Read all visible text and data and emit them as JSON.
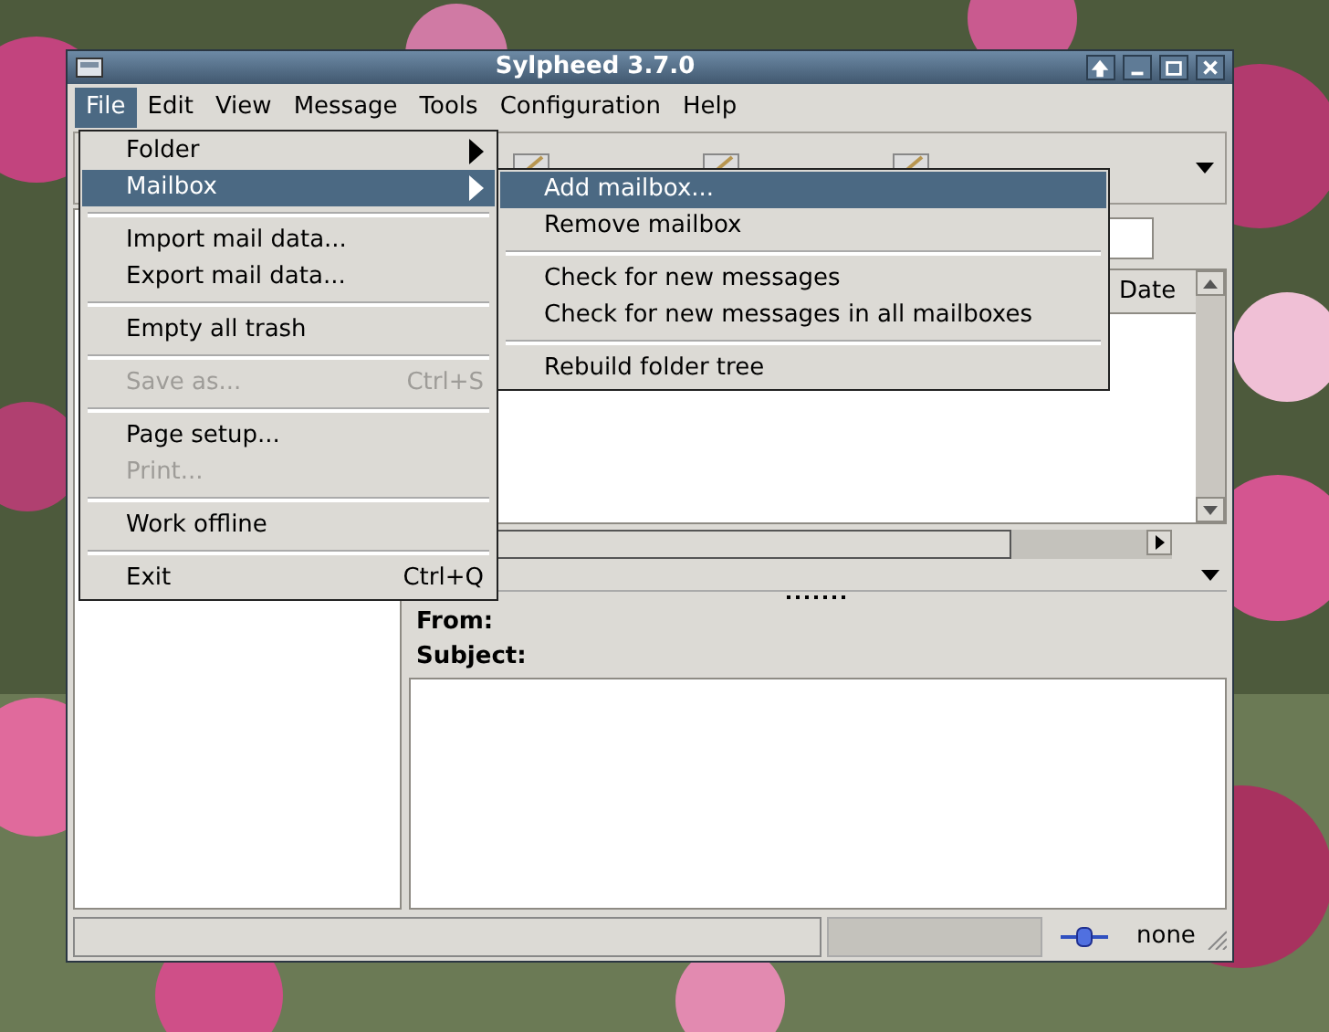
{
  "window": {
    "title": "Sylpheed 3.7.0"
  },
  "menubar": [
    {
      "label": "File",
      "selected": true
    },
    {
      "label": "Edit",
      "selected": false
    },
    {
      "label": "View",
      "selected": false
    },
    {
      "label": "Message",
      "selected": false
    },
    {
      "label": "Tools",
      "selected": false
    },
    {
      "label": "Configuration",
      "selected": false
    },
    {
      "label": "Help",
      "selected": false
    }
  ],
  "file_menu": [
    {
      "kind": "item",
      "label": "Folder",
      "submenu": true,
      "selected": false,
      "disabled": false
    },
    {
      "kind": "item",
      "label": "Mailbox",
      "submenu": true,
      "selected": true,
      "disabled": false
    },
    {
      "kind": "separator"
    },
    {
      "kind": "item",
      "label": "Import mail data...",
      "submenu": false,
      "selected": false,
      "disabled": false
    },
    {
      "kind": "item",
      "label": "Export mail data...",
      "submenu": false,
      "selected": false,
      "disabled": false
    },
    {
      "kind": "separator"
    },
    {
      "kind": "item",
      "label": "Empty all trash",
      "submenu": false,
      "selected": false,
      "disabled": false
    },
    {
      "kind": "separator"
    },
    {
      "kind": "item",
      "label": "Save as...",
      "shortcut": "Ctrl+S",
      "submenu": false,
      "selected": false,
      "disabled": true
    },
    {
      "kind": "separator"
    },
    {
      "kind": "item",
      "label": "Page setup...",
      "submenu": false,
      "selected": false,
      "disabled": false
    },
    {
      "kind": "item",
      "label": "Print...",
      "submenu": false,
      "selected": false,
      "disabled": true
    },
    {
      "kind": "separator"
    },
    {
      "kind": "item",
      "label": "Work offline",
      "submenu": false,
      "selected": false,
      "disabled": false
    },
    {
      "kind": "separator"
    },
    {
      "kind": "item",
      "label": "Exit",
      "shortcut": "Ctrl+Q",
      "submenu": false,
      "selected": false,
      "disabled": false
    }
  ],
  "mailbox_submenu": [
    {
      "kind": "item",
      "label": "Add mailbox...",
      "selected": true,
      "disabled": false
    },
    {
      "kind": "item",
      "label": "Remove mailbox",
      "selected": false,
      "disabled": false
    },
    {
      "kind": "separator"
    },
    {
      "kind": "item",
      "label": "Check for new messages",
      "selected": false,
      "disabled": false
    },
    {
      "kind": "item",
      "label": "Check for new messages in all mailboxes",
      "selected": false,
      "disabled": false
    },
    {
      "kind": "separator"
    },
    {
      "kind": "item",
      "label": "Rebuild folder tree",
      "selected": false,
      "disabled": false
    }
  ],
  "message_list": {
    "columns": [
      "Date"
    ]
  },
  "preview": {
    "from_label": "From:",
    "subject_label": "Subject:"
  },
  "status_bar": {
    "online_status": "none"
  }
}
